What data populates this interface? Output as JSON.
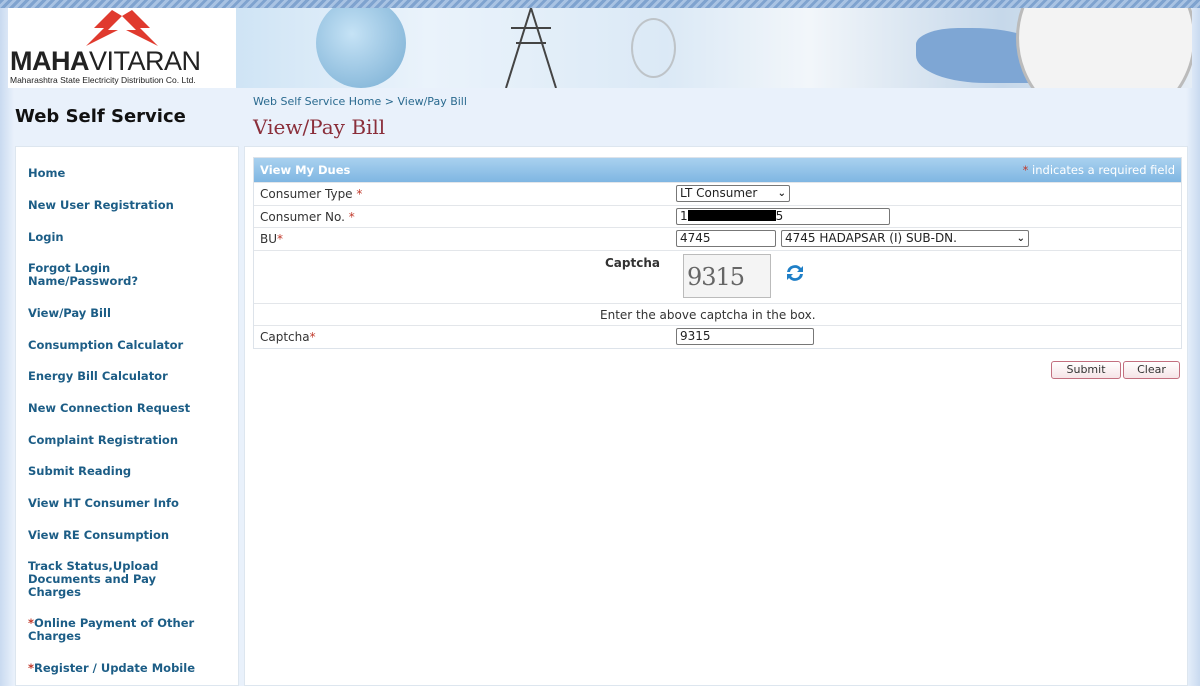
{
  "header": {
    "logo_text_bold": "MAHA",
    "logo_text_light": "VITARAN",
    "logo_tagline": "Maharashtra State Electricity Distribution Co. Ltd.",
    "brand_color": "#e03a2e"
  },
  "site_title": "Web Self Service",
  "breadcrumb": "Web Self Service Home > View/Pay Bill",
  "page_title": "View/Pay Bill",
  "sidebar": {
    "items": [
      {
        "label": "Home"
      },
      {
        "label": "New User Registration"
      },
      {
        "label": "Login"
      },
      {
        "label": "Forgot Login Name/Password?"
      },
      {
        "label": "View/Pay Bill"
      },
      {
        "label": "Consumption Calculator"
      },
      {
        "label": "Energy Bill Calculator"
      },
      {
        "label": "New Connection Request"
      },
      {
        "label": "Complaint Registration"
      },
      {
        "label": "Submit Reading"
      },
      {
        "label": "View HT Consumer Info"
      },
      {
        "label": "View RE Consumption"
      },
      {
        "label": "Track Status,Upload Documents and Pay Charges"
      },
      {
        "star": "*",
        "label": "Online Payment of Other Charges"
      },
      {
        "star": "*",
        "label": "Register / Update Mobile"
      }
    ]
  },
  "form": {
    "title": "View My Dues",
    "required_star": "*",
    "required_note": " indicates a required field",
    "consumer_type_label": "Consumer Type ",
    "consumer_type_value": "LT Consumer",
    "consumer_no_label": "Consumer No. ",
    "consumer_no_value_start": "1",
    "consumer_no_value_end": "5",
    "bu_label": "BU",
    "bu_code": "4745",
    "bu_select": "4745 HADAPSAR (I) SUB-DN.",
    "captcha_heading": "Captcha",
    "captcha_image_text": "9315",
    "captcha_hint": "Enter the above captcha in the box.",
    "captcha_label": "Captcha",
    "captcha_value": "9315",
    "submit": "Submit",
    "clear": "Clear"
  }
}
